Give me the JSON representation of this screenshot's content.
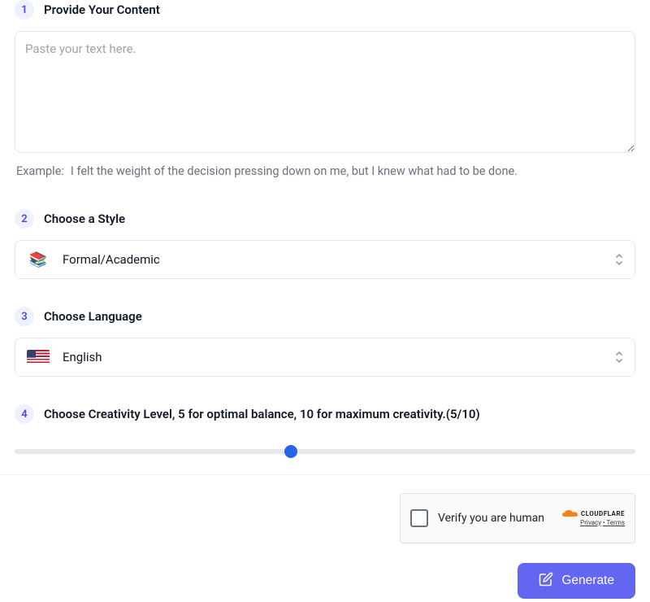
{
  "step1": {
    "number": "1",
    "title": "Provide Your Content",
    "placeholder": "Paste your text here.",
    "example_label": "Example:",
    "example_text": "I felt the weight of the decision pressing down on me, but I knew what had to be done."
  },
  "step2": {
    "number": "2",
    "title": "Choose a Style",
    "selected": "Formal/Academic"
  },
  "step3": {
    "number": "3",
    "title": "Choose Language",
    "selected": "English"
  },
  "step4": {
    "number": "4",
    "title": "Choose Creativity Level, 5 for optimal balance, 10 for maximum creativity.(5/10)",
    "value": 5,
    "min": 1,
    "max": 10
  },
  "captcha": {
    "label": "Verify you are human",
    "brand": "CLOUDFLARE",
    "privacy": "Privacy",
    "terms": "Terms"
  },
  "generate": {
    "label": "Generate"
  },
  "colors": {
    "accent": "#6366f1",
    "badge_bg": "#eef2ff",
    "badge_fg": "#4f46e5",
    "border": "#e5e7eb",
    "muted": "#6b7280",
    "slider_thumb": "#2563eb"
  }
}
